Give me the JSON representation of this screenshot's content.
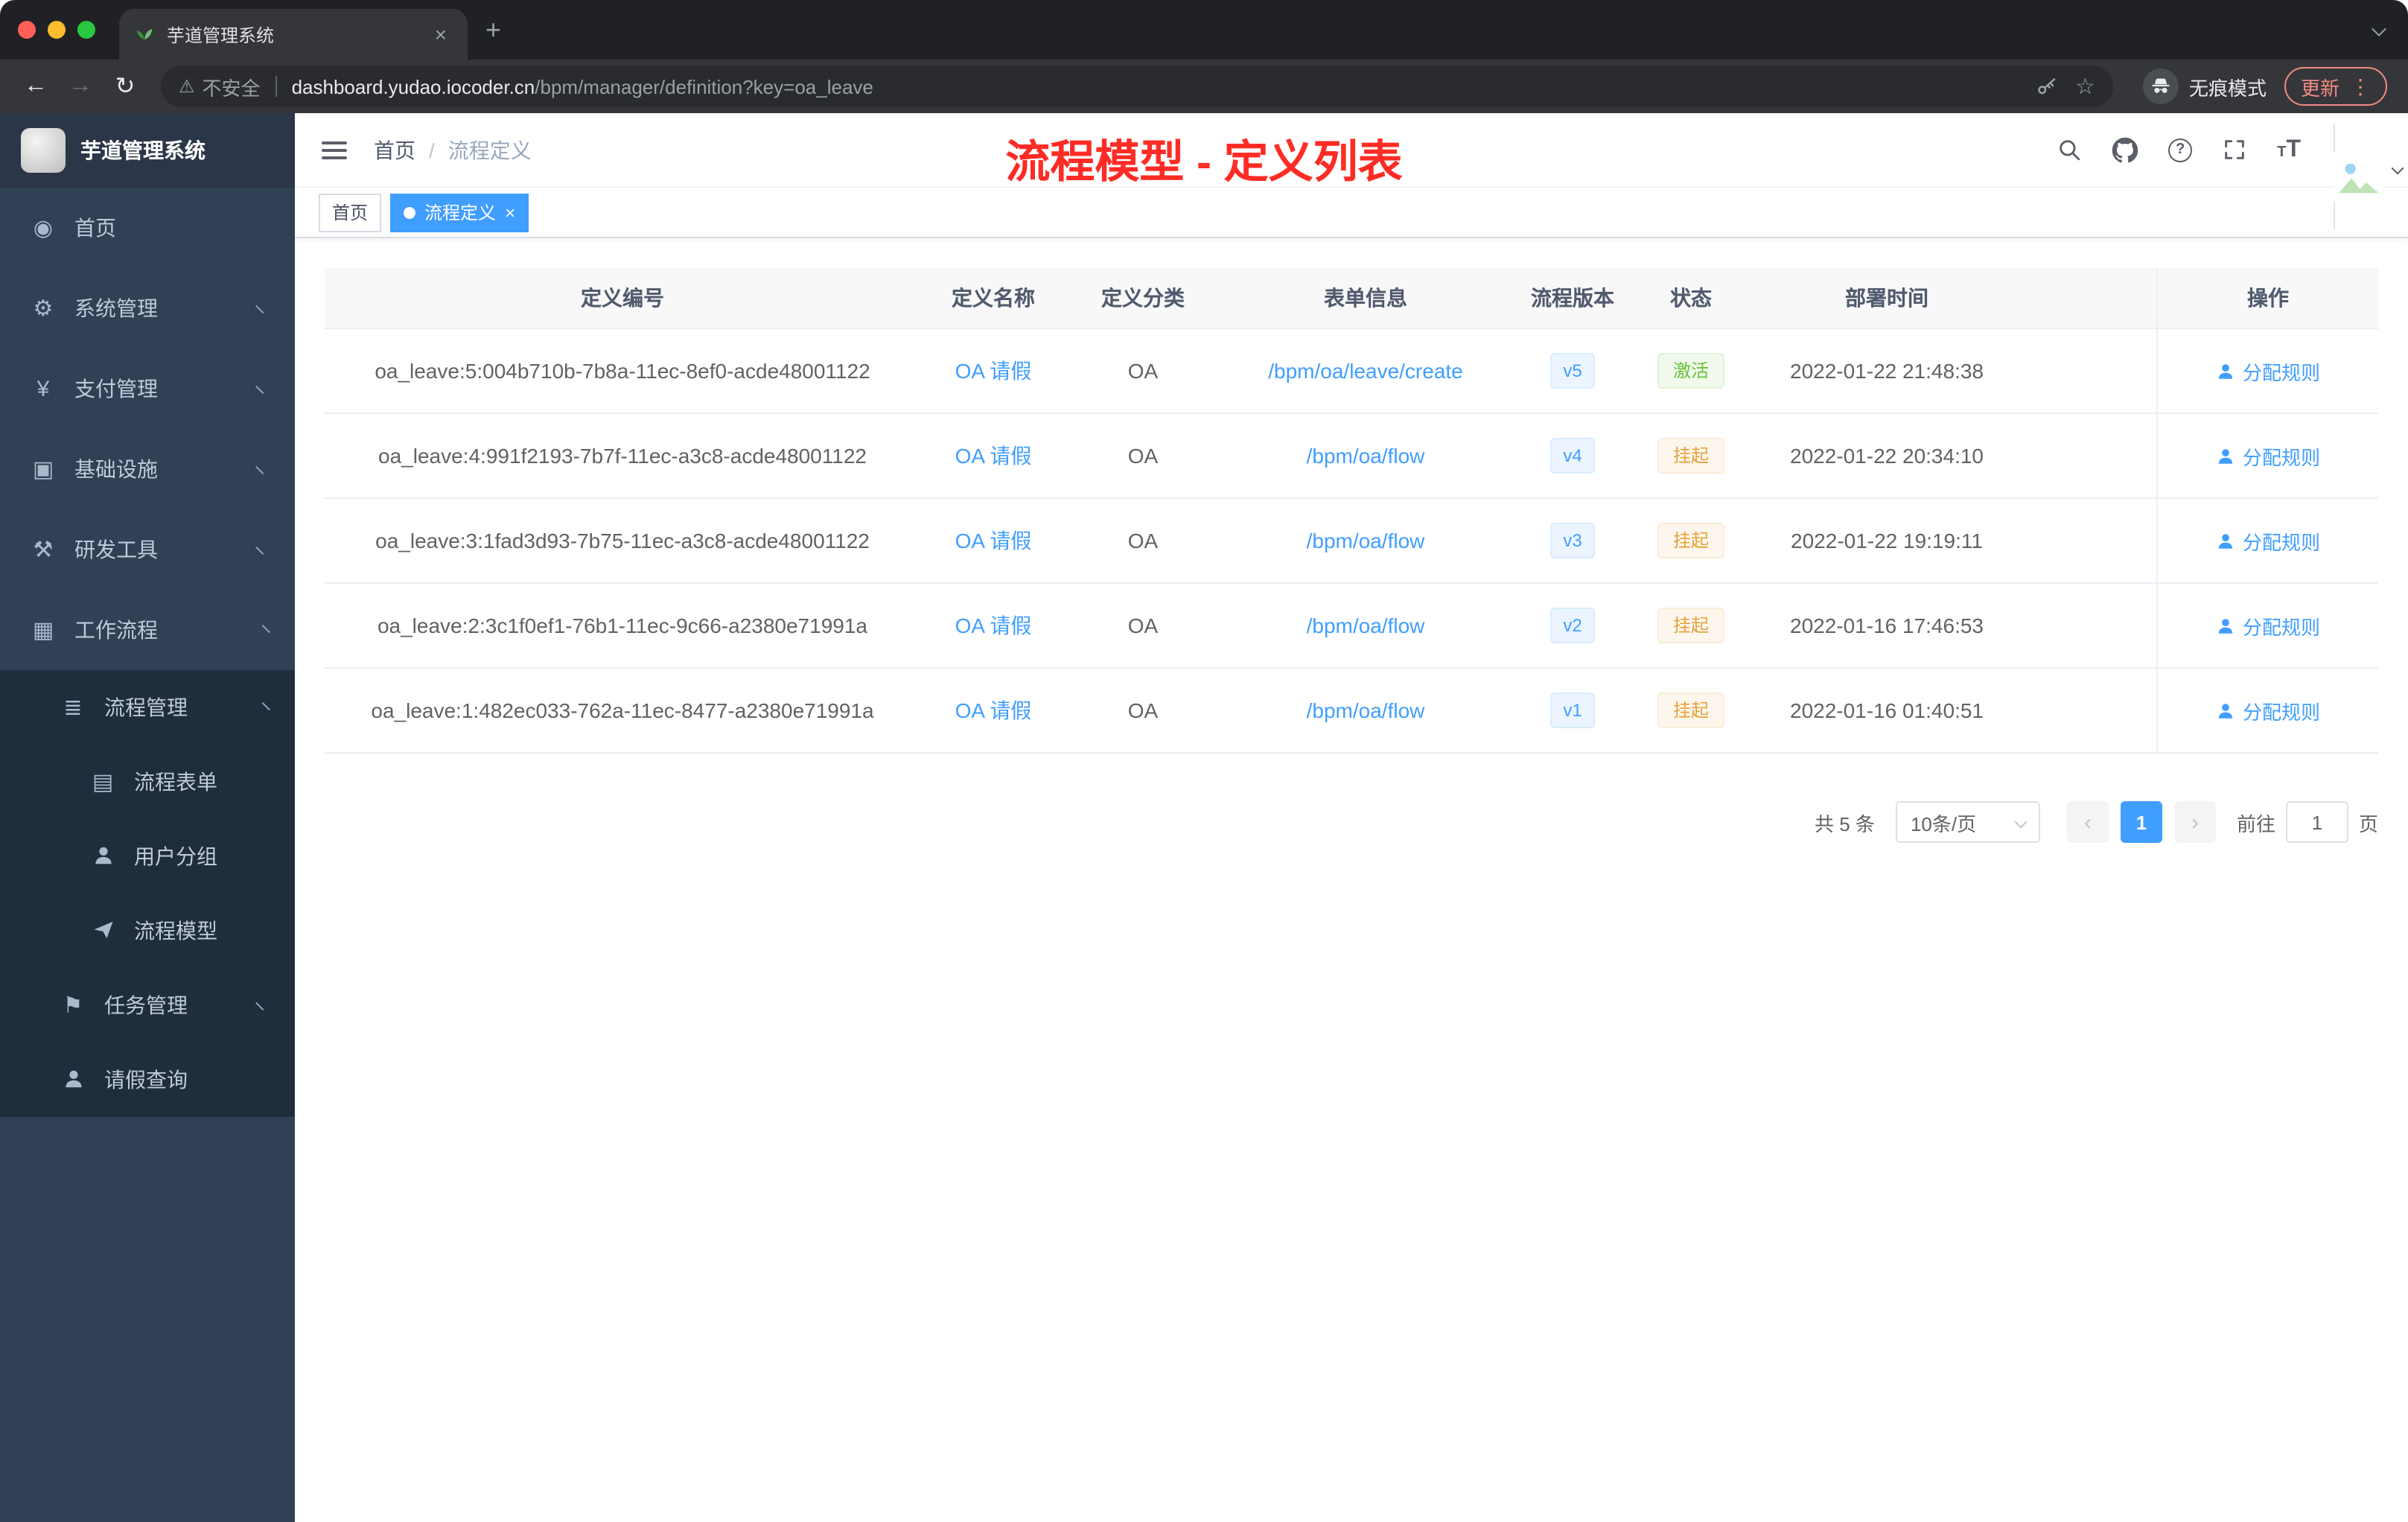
{
  "browser": {
    "tab_title": "芋道管理系统",
    "security_label": "不安全",
    "url_host": "dashboard.yudao.iocoder.cn",
    "url_path": "/bpm/manager/definition?key=oa_leave",
    "incognito_label": "无痕模式",
    "update_label": "更新"
  },
  "sidebar": {
    "logo_title": "芋道管理系统",
    "menu": {
      "home": "首页",
      "system": "系统管理",
      "payment": "支付管理",
      "infrastructure": "基础设施",
      "devtools": "研发工具",
      "workflow": "工作流程",
      "process_mgmt": "流程管理",
      "process_form": "流程表单",
      "user_group": "用户分组",
      "process_model": "流程模型",
      "task_mgmt": "任务管理",
      "leave_query": "请假查询"
    }
  },
  "header": {
    "breadcrumb_home": "首页",
    "breadcrumb_current": "流程定义",
    "annotation_title": "流程模型 - 定义列表"
  },
  "tags": {
    "home": "首页",
    "active": "流程定义"
  },
  "table": {
    "columns": [
      "定义编号",
      "定义名称",
      "定义分类",
      "表单信息",
      "流程版本",
      "状态",
      "部署时间",
      "操作"
    ],
    "rows": [
      {
        "id": "oa_leave:5:004b710b-7b8a-11ec-8ef0-acde48001122",
        "name": "OA 请假",
        "category": "OA",
        "form": "/bpm/oa/leave/create",
        "version": "v5",
        "status_label": "激活",
        "status_type": "success",
        "deploy_time": "2022-01-22 21:48:38",
        "action": "分配规则"
      },
      {
        "id": "oa_leave:4:991f2193-7b7f-11ec-a3c8-acde48001122",
        "name": "OA 请假",
        "category": "OA",
        "form": "/bpm/oa/flow",
        "version": "v4",
        "status_label": "挂起",
        "status_type": "warning",
        "deploy_time": "2022-01-22 20:34:10",
        "action": "分配规则"
      },
      {
        "id": "oa_leave:3:1fad3d93-7b75-11ec-a3c8-acde48001122",
        "name": "OA 请假",
        "category": "OA",
        "form": "/bpm/oa/flow",
        "version": "v3",
        "status_label": "挂起",
        "status_type": "warning",
        "deploy_time": "2022-01-22 19:19:11",
        "action": "分配规则"
      },
      {
        "id": "oa_leave:2:3c1f0ef1-76b1-11ec-9c66-a2380e71991a",
        "name": "OA 请假",
        "category": "OA",
        "form": "/bpm/oa/flow",
        "version": "v2",
        "status_label": "挂起",
        "status_type": "warning",
        "deploy_time": "2022-01-16 17:46:53",
        "action": "分配规则"
      },
      {
        "id": "oa_leave:1:482ec033-762a-11ec-8477-a2380e71991a",
        "name": "OA 请假",
        "category": "OA",
        "form": "/bpm/oa/flow",
        "version": "v1",
        "status_label": "挂起",
        "status_type": "warning",
        "deploy_time": "2022-01-16 01:40:51",
        "action": "分配规则"
      }
    ]
  },
  "pagination": {
    "total": "共 5 条",
    "page_size": "10条/页",
    "current_page": "1",
    "goto_label": "前往",
    "goto_value": "1",
    "unit_label": "页"
  },
  "colors": {
    "accent": "#409eff",
    "success": "#67c23a",
    "warning": "#e6a23c",
    "annotation_red": "#fe2c25",
    "sidebar_bg": "#304156",
    "submenu_bg": "#1f2d3d"
  }
}
